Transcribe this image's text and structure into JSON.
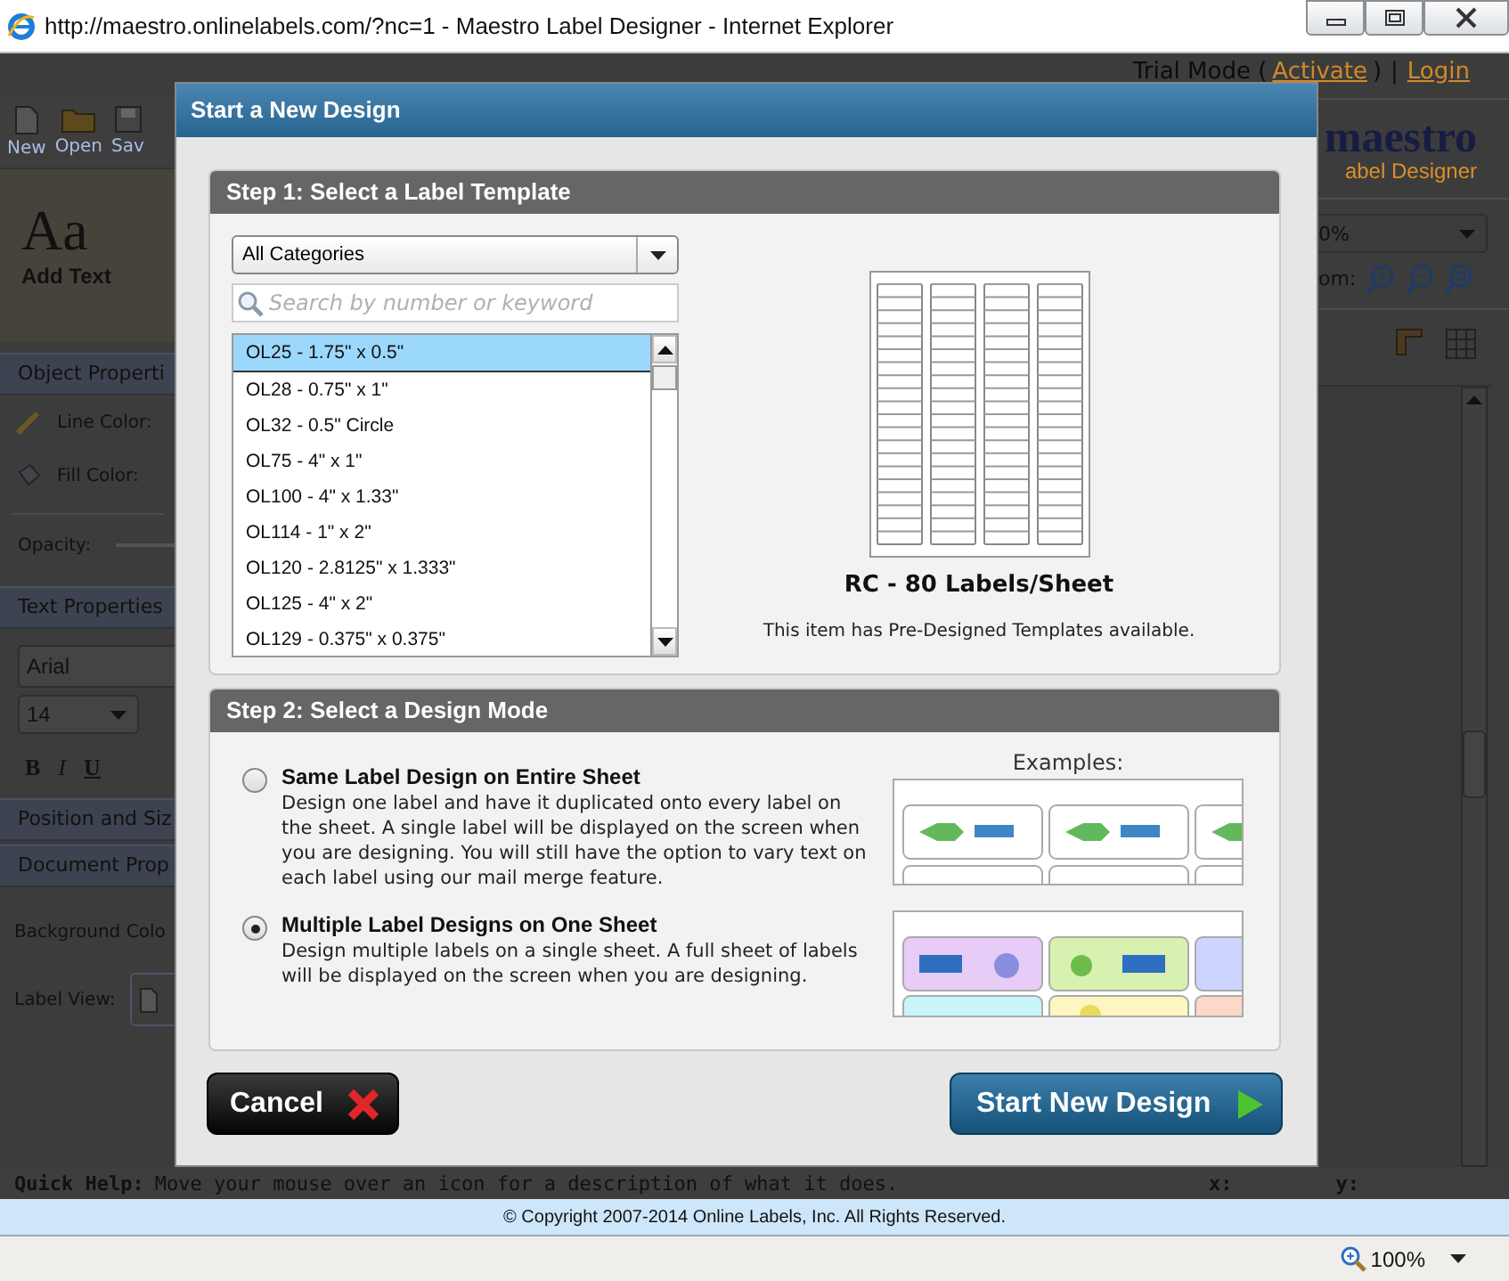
{
  "window": {
    "title": "http://maestro.onlinelabels.com/?nc=1 - Maestro Label Designer - Internet Explorer"
  },
  "app_header": {
    "trial_mode": "Trial Mode (",
    "activate_link": "Activate",
    "close_paren": ")",
    "separator": "|",
    "login_link": "Login"
  },
  "toolbar": [
    {
      "label": "New"
    },
    {
      "label": "Open"
    },
    {
      "label": "Sav"
    }
  ],
  "add_text": {
    "sample": "Aa",
    "label": "Add Text"
  },
  "object_properties": {
    "title": "Object Properti",
    "line_color": "Line Color:",
    "fill_color": "Fill Color:",
    "opacity": "Opacity:"
  },
  "text_properties": {
    "title": "Text Properties",
    "font": "Arial",
    "size": "14",
    "format": [
      "B",
      "I",
      "U"
    ]
  },
  "position_title": "Position and Siz",
  "document_properties": {
    "title": "Document Prop",
    "background_color": "Background Colo",
    "label_view": "Label View:"
  },
  "logo": {
    "name": "maestro",
    "subtitle": "abel Designer"
  },
  "zoom": {
    "value": "0%",
    "label": "om:"
  },
  "quick_help": {
    "label": "Quick Help:",
    "text": "Move your mouse over an icon for a description of what it does.",
    "x_label": "x:",
    "y_label": "y:"
  },
  "copyright": "© Copyright 2007-2014 Online Labels, Inc. All Rights Reserved.",
  "browser_status": {
    "zoom": "100%"
  },
  "dialog": {
    "title": "Start a New Design",
    "step1": {
      "title": "Step 1: Select a Label Template",
      "category": "All Categories",
      "search_placeholder": "Search by number or keyword",
      "templates": [
        {
          "label": "OL25 - 1.75\" x 0.5\"",
          "selected": true
        },
        {
          "label": "OL28 - 0.75\" x 1\"",
          "selected": false
        },
        {
          "label": "OL32 - 0.5\" Circle",
          "selected": false
        },
        {
          "label": "OL75 - 4\" x 1\"",
          "selected": false
        },
        {
          "label": "OL100 - 4\" x 1.33\"",
          "selected": false
        },
        {
          "label": "OL114 - 1\" x 2\"",
          "selected": false
        },
        {
          "label": "OL120 - 2.8125\" x 1.333\"",
          "selected": false
        },
        {
          "label": "OL125 - 4\" x 2\"",
          "selected": false
        },
        {
          "label": "OL129 - 0.375\" x 0.375\"",
          "selected": false
        }
      ],
      "preview_title": "RC - 80 Labels/Sheet",
      "preview_note": "This item has Pre-Designed Templates available."
    },
    "step2": {
      "title": "Step 2: Select a Design Mode",
      "examples_label": "Examples:",
      "modes": [
        {
          "title": "Same Label Design on Entire Sheet",
          "description": "Design one label and have it duplicated onto every label on the sheet. A single label will be displayed on the screen when you are designing. You will still have the option to vary text on each label using our mail merge feature.",
          "selected": false
        },
        {
          "title": "Multiple Label Designs on One Sheet",
          "description": "Design multiple labels on a single sheet. A full sheet of labels will be displayed on the screen when you are designing.",
          "selected": true
        }
      ]
    },
    "buttons": {
      "cancel": "Cancel",
      "start": "Start New Design"
    }
  }
}
